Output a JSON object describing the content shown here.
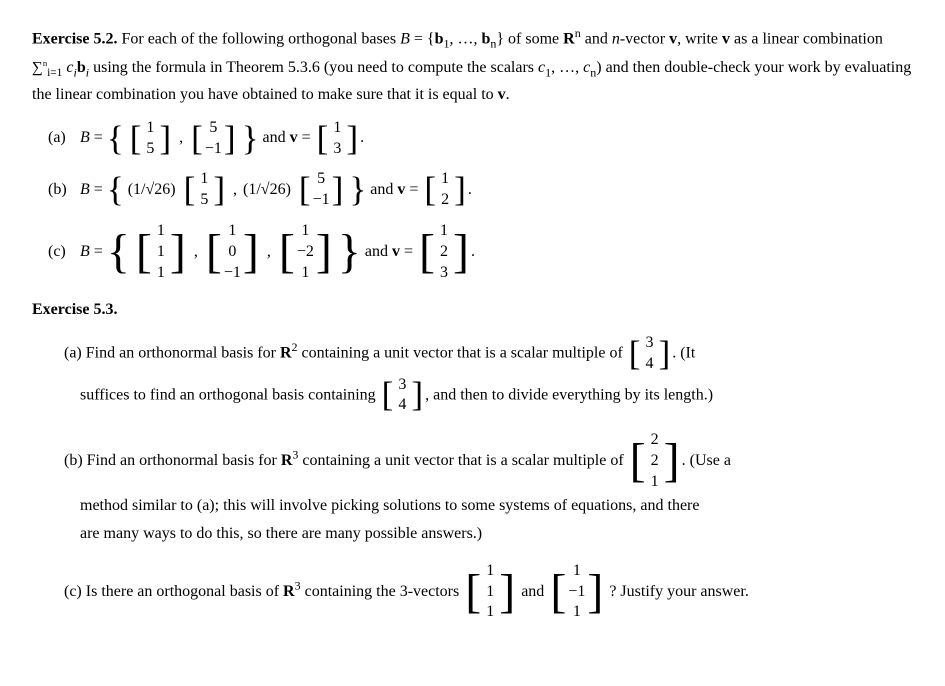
{
  "exercise52": {
    "title": "Exercise 5.2.",
    "intro": "For each of the following orthogonal bases",
    "B_def": "B = {b₁, …, bₙ} of some Rⁿ and n-vector v, write v as a linear combination",
    "sum_formula": "∑ᵢ₌₁ⁿ cᵢbᵢ using the formula in Theorem 5.3.6 (you need to compute the scalars c₁, …, cₙ) and then double-check your work by evaluating the linear combination you have obtained to make sure that it is equal to v.",
    "parts": {
      "a": {
        "label": "(a)",
        "B_prefix": "B =",
        "B_vectors": [
          [
            "1",
            "5"
          ],
          [
            "5",
            "-1"
          ]
        ],
        "and_v": "and v =",
        "v": [
          "1",
          "3"
        ]
      },
      "b": {
        "label": "(b)",
        "B_prefix": "B =",
        "B_vectors_scaled": [
          "(1/√26)",
          "(1/√26)"
        ],
        "B_v1": [
          "1",
          "5"
        ],
        "B_v2": [
          "5",
          "-1"
        ],
        "and_v": "and v =",
        "v": [
          "1",
          "2"
        ]
      },
      "c": {
        "label": "(c)",
        "B_prefix": "B =",
        "B_vectors": [
          [
            "1",
            "1",
            "1"
          ],
          [
            "1",
            "0",
            "-1"
          ],
          [
            "1",
            "-2",
            "1"
          ]
        ],
        "and_v": "and v =",
        "v": [
          "1",
          "2",
          "3"
        ]
      }
    }
  },
  "exercise53": {
    "title": "Exercise 5.3.",
    "parts": {
      "a": {
        "label": "(a)",
        "text1": "Find an orthonormal basis for",
        "Rn": "R²",
        "text2": "containing a unit vector that is a scalar multiple of",
        "vector": [
          "3",
          "4"
        ],
        "text3": ". (It",
        "text4": "suffices to find an orthogonal basis containing",
        "vector2": [
          "3",
          "4"
        ],
        "text5": ", and then to divide everything by its length.)"
      },
      "b": {
        "label": "(b)",
        "text1": "Find an orthonormal basis for",
        "Rn": "R³",
        "text2": "containing a unit vector that is a scalar multiple of",
        "vector": [
          "2",
          "2",
          "1"
        ],
        "text3": ". (Use a",
        "text4": "method similar to (a); this will involve picking solutions to some systems of equations, and there are many ways to do this, so there are many possible answers.)"
      },
      "c": {
        "label": "(c)",
        "text1": "Is there an orthogonal basis of",
        "Rn": "R³",
        "text2": "containing the 3-vectors",
        "v1": [
          "1",
          "1",
          "1"
        ],
        "and": "and",
        "v2": [
          "1",
          "-1",
          "1"
        ],
        "text3": "? Justify your answer."
      }
    }
  }
}
